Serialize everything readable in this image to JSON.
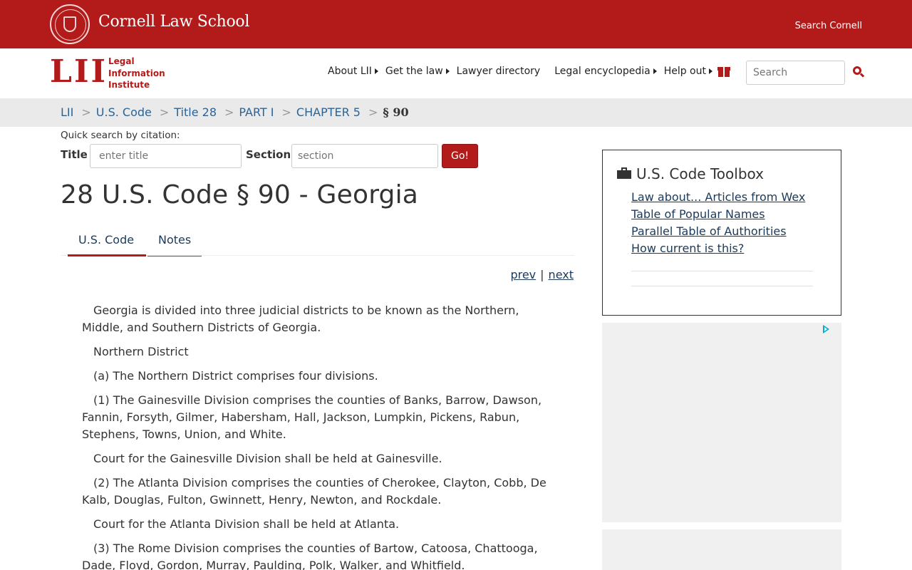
{
  "cornell_bar": {
    "title": "Cornell Law School",
    "search_label": "Search Cornell"
  },
  "lii_logo": {
    "mark": "LII",
    "words": [
      "Legal",
      "Information",
      "Institute"
    ]
  },
  "main_nav": {
    "items": [
      {
        "label": "About LII",
        "has_caret": true
      },
      {
        "label": "Get the law",
        "has_caret": true
      },
      {
        "label": "Lawyer directory",
        "has_caret": false
      },
      {
        "label": "Legal encyclopedia",
        "has_caret": true
      },
      {
        "label": "Help out",
        "has_caret": true
      }
    ],
    "gift_icon": "gift-icon",
    "search_placeholder": "Search",
    "search_icon": "search-icon"
  },
  "breadcrumb": {
    "items": [
      "LII",
      "U.S. Code",
      "Title 28",
      "PART I",
      "CHAPTER 5"
    ],
    "separator": ">",
    "current": "§ 90"
  },
  "quick_search": {
    "label": "Quick search by citation:",
    "title_label": "Title",
    "title_placeholder": "enter title",
    "section_label": "Section",
    "section_placeholder": "section",
    "go_label": "Go!"
  },
  "page": {
    "title": "28 U.S. Code § 90 - Georgia"
  },
  "tabs": [
    {
      "label": "U.S. Code",
      "active": true
    },
    {
      "label": "Notes",
      "active": false
    }
  ],
  "pager": {
    "prev": "prev",
    "divider": "|",
    "next": "next"
  },
  "statute_paragraphs": [
    "Georgia is divided into three judicial districts to be known as the Northern, Middle, and Southern Districts of Georgia.",
    "Northern District",
    "(a) The Northern District comprises four divisions.",
    "(1) The Gainesville Division comprises the counties of Banks, Barrow, Dawson, Fannin, Forsyth, Gilmer, Habersham, Hall, Jackson, Lumpkin, Pickens, Rabun, Stephens, Towns, Union, and White.",
    "Court for the Gainesville Division shall be held at Gainesville.",
    "(2) The Atlanta Division comprises the counties of Cherokee, Clayton, Cobb, De Kalb, Douglas, Fulton, Gwinnett, Henry, Newton, and Rockdale.",
    "Court for the Atlanta Division shall be held at Atlanta.",
    "(3) The Rome Division comprises the counties of Bartow, Catoosa, Chattooga, Dade, Floyd, Gordon, Murray, Paulding, Polk, Walker, and Whitfield."
  ],
  "toolbox": {
    "title": "U.S. Code Toolbox",
    "icon": "briefcase-icon",
    "links": [
      "Law about... Articles from Wex",
      "Table of Popular Names",
      "Parallel Table of Authorities",
      "How current is this?"
    ]
  },
  "ads": {
    "adchoices_icon": "adchoices-icon"
  },
  "colors": {
    "cornell_red": "#b31b1b",
    "link_blue": "#1a3a5c",
    "breadcrumb_bg": "#eaeaea",
    "ad_bg": "#f0f0f0"
  }
}
